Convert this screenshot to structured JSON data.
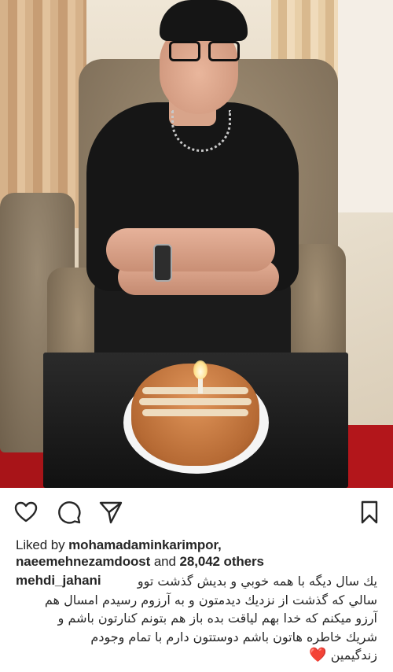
{
  "photo": {
    "alt_subject": "birthday-cake-photo"
  },
  "actions": {
    "like_icon": "heart-outline-icon",
    "comment_icon": "comment-icon",
    "share_icon": "paper-plane-icon",
    "save_icon": "bookmark-icon"
  },
  "likes": {
    "prefix": "Liked by",
    "user1": "mohamadaminkarimpor,",
    "user2": "naeemehnezamdoost",
    "connector": "and",
    "others": "28,042 others"
  },
  "caption": {
    "username": "mehdi_jahani",
    "lines": [
      "يك سال ديگه با همه خوبي و بديش گذشت توو",
      "سالي كه گذشت از نزديك ديدمتون و به آرزوم رسيدم امسال هم",
      "آرزو ميكنم كه خدا بهم لياقت بده باز هم بتونم كنارتون باشم و",
      "شريك خاطره هاتون باشم دوستتون دارم با تمام وجودم",
      "زندگيمين"
    ],
    "emoji": "❤️"
  },
  "colors": {
    "text": "#262626",
    "heart_emoji": "#e5142a",
    "icon_stroke": "#262626"
  }
}
